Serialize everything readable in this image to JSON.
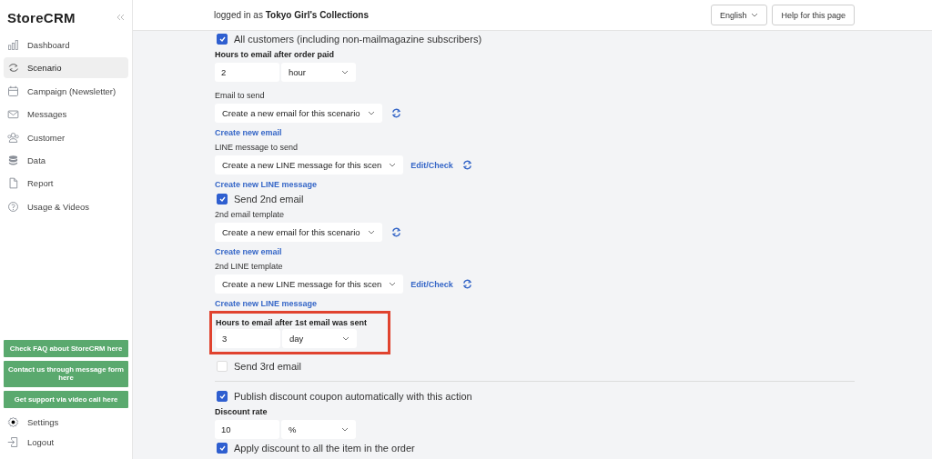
{
  "sidebar": {
    "logo": "StoreCRM",
    "items": [
      {
        "label": "Dashboard",
        "selected": false
      },
      {
        "label": "Scenario",
        "selected": true
      },
      {
        "label": "Campaign (Newsletter)",
        "selected": false
      },
      {
        "label": "Messages",
        "selected": false
      },
      {
        "label": "Customer",
        "selected": false
      },
      {
        "label": "Data",
        "selected": false
      },
      {
        "label": "Report",
        "selected": false
      },
      {
        "label": "Usage & Videos",
        "selected": false
      }
    ],
    "support_buttons": [
      "Check FAQ about StoreCRM here",
      "Contact us through message form here",
      "Get support via video call here"
    ],
    "footer_items": [
      "Settings",
      "Logout"
    ]
  },
  "header": {
    "login_prefix": "logged in as",
    "account": "Tokyo Girl's Collections",
    "language": "English",
    "help": "Help for this page"
  },
  "form": [
    {
      "kind": "checkbox",
      "label": "All customers (including non-mailmagazine subscribers)",
      "checked": true
    },
    {
      "kind": "amount",
      "label": "Hours to email after order paid",
      "value": "2",
      "unit": "hour",
      "highlighted": false
    },
    {
      "kind": "select",
      "label": "Email to send",
      "value": "Create a new email for this scenario"
    },
    {
      "kind": "link",
      "label": "Create new email"
    },
    {
      "kind": "select",
      "label": "LINE message to send",
      "value": "Create a new LINE message for this scen",
      "edit_link": "Edit/Check"
    },
    {
      "kind": "link",
      "label": "Create new LINE message"
    },
    {
      "kind": "checkbox",
      "label": "Send 2nd email",
      "checked": true
    },
    {
      "kind": "select",
      "label": "2nd email template",
      "value": "Create a new email for this scenario"
    },
    {
      "kind": "link",
      "label": "Create new email"
    },
    {
      "kind": "select",
      "label": "2nd LINE template",
      "value": "Create a new LINE message for this scen",
      "edit_link": "Edit/Check"
    },
    {
      "kind": "link",
      "label": "Create new LINE message"
    },
    {
      "kind": "amount",
      "label": "Hours to email after 1st email was sent",
      "value": "3",
      "unit": "day",
      "highlighted": true
    },
    {
      "kind": "checkbox",
      "label": "Send 3rd email",
      "checked": false
    },
    {
      "kind": "divider"
    },
    {
      "kind": "checkbox",
      "label": "Publish discount coupon automatically with this action",
      "checked": true
    },
    {
      "kind": "amount",
      "label": "Discount rate",
      "value": "10",
      "unit": "%",
      "highlighted": false
    },
    {
      "kind": "checkbox",
      "label": "Apply discount to all the item in the order",
      "checked": true
    }
  ]
}
